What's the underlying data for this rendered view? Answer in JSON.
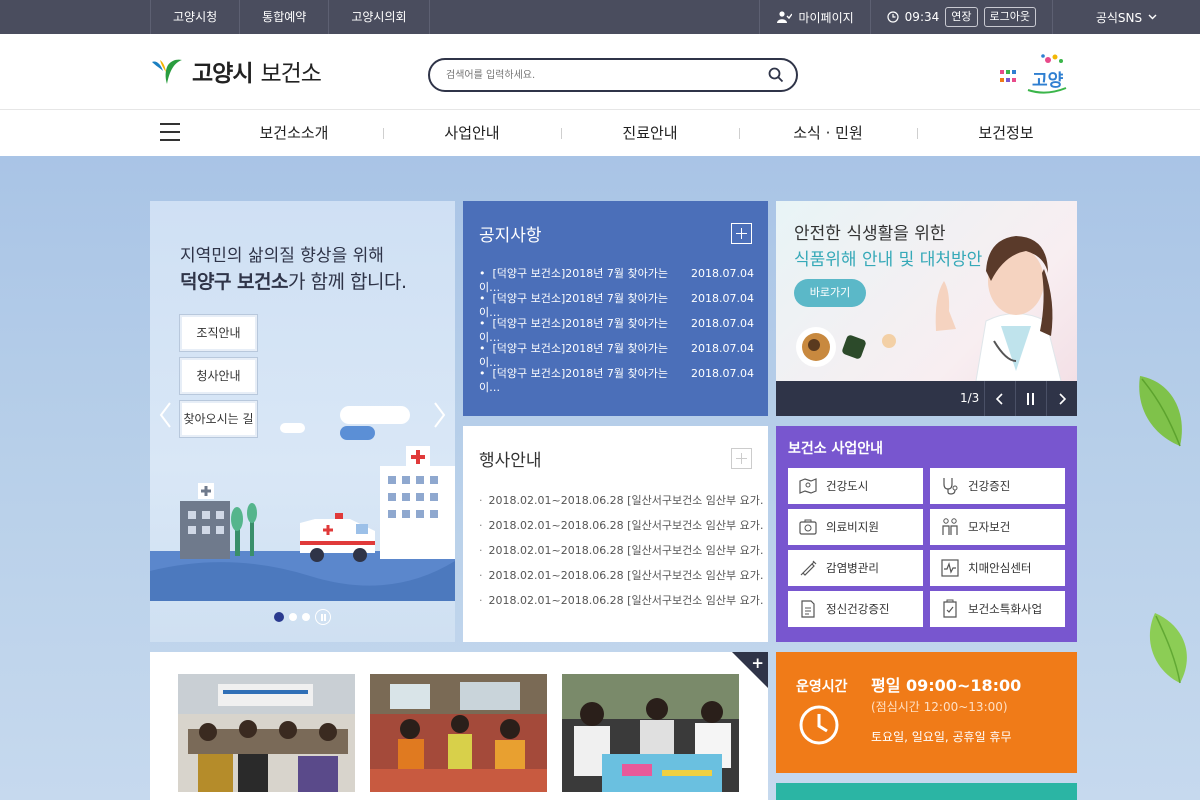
{
  "topbar": {
    "links": [
      "고양시청",
      "통합예약",
      "고양시의회"
    ],
    "mypage": "마이페이지",
    "time": "09:34",
    "extend": "연장",
    "logout": "로그아웃",
    "sns": "공식SNS"
  },
  "header": {
    "logo_main": "고양시",
    "logo_sub": "보건소",
    "search_placeholder": "검색어를 입력하세요.",
    "brand_text": "고양"
  },
  "nav": {
    "items": [
      "보건소소개",
      "사업안내",
      "진료안내",
      "소식 · 민원",
      "보건정보"
    ]
  },
  "hero": {
    "line1": "지역민의 삶의질 향상을 위해",
    "line2_bold": "덕양구 보건소",
    "line2_rest": "가 함께 합니다.",
    "buttons": [
      "조직안내",
      "청사안내",
      "찾아오시는 길"
    ]
  },
  "notice": {
    "title": "공지사항",
    "items": [
      {
        "text": "[덕양구 보건소]2018년 7월 찾아가는 이…",
        "date": "2018.07.04"
      },
      {
        "text": "[덕양구 보건소]2018년 7월 찾아가는 이…",
        "date": "2018.07.04"
      },
      {
        "text": "[덕양구 보건소]2018년 7월 찾아가는 이…",
        "date": "2018.07.04"
      },
      {
        "text": "[덕양구 보건소]2018년 7월 찾아가는 이…",
        "date": "2018.07.04"
      },
      {
        "text": "[덕양구 보건소]2018년 7월 찾아가는 이…",
        "date": "2018.07.04"
      }
    ]
  },
  "event": {
    "title": "행사안내",
    "items": [
      "2018.02.01~2018.06.28 [일산서구보건소 임산부 요가…",
      "2018.02.01~2018.06.28 [일산서구보건소 임산부 요가…",
      "2018.02.01~2018.06.28 [일산서구보건소 임산부 요가…",
      "2018.02.01~2018.06.28 [일산서구보건소 임산부 요가…",
      "2018.02.01~2018.06.28 [일산서구보건소 임산부 요가…"
    ]
  },
  "promo": {
    "line1": "안전한 식생활을 위한",
    "line2": "식품위해 안내 및 대처방안",
    "button": "바로가기",
    "counter": "1/3"
  },
  "biz": {
    "title": "보건소 사업안내",
    "items": [
      "건강도시",
      "건강증진",
      "의료비지원",
      "모자보건",
      "감염병관리",
      "치매안심센터",
      "정신건강증진",
      "보건소특화사업"
    ]
  },
  "hours": {
    "label": "운영시간",
    "weekday": "평일 09:00~18:00",
    "lunch": "(점심시간 12:00~13:00)",
    "closed": "토요일, 일요일, 공휴일 휴무"
  },
  "colors": {
    "topbar": "#4a4d5e",
    "notice": "#4b6fb9",
    "biz": "#7856cf",
    "hours": "#f07b18",
    "teal": "#2bb5a4",
    "dark": "#2f3448"
  }
}
